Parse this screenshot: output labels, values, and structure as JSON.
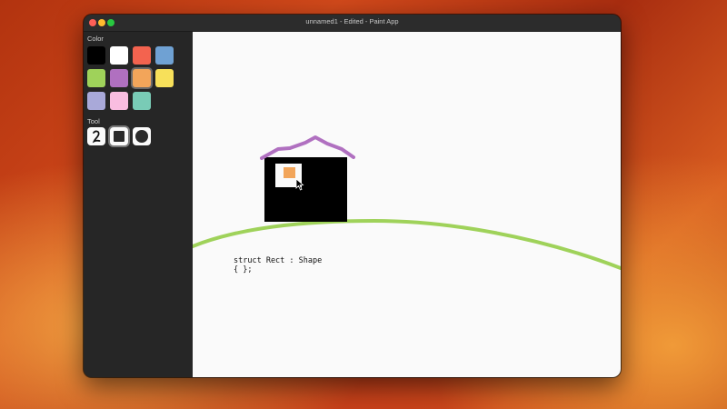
{
  "window": {
    "title": "unnamed1 - Edited - Paint App"
  },
  "sidebar": {
    "color_label": "Color",
    "tool_label": "Tool",
    "colors": [
      "#000000",
      "#ffffff",
      "#f3634f",
      "#6fa1d3",
      "#9fd25a",
      "#b070c0",
      "#f2a55a",
      "#f7e05a",
      "#a9a9d9",
      "#f9bde0",
      "#79cbb6"
    ],
    "selected_color": "#f2a55a",
    "tools": [
      "pen",
      "rectangle",
      "ellipse"
    ],
    "selected_tool": "rectangle"
  },
  "canvas": {
    "text_lines": [
      "struct Rect : Shape",
      "{ };"
    ],
    "stroke_colors": {
      "roof": "#b070c0",
      "hill": "#9fd25a",
      "house": "#000000",
      "window_fill": "#f2a55a"
    }
  }
}
